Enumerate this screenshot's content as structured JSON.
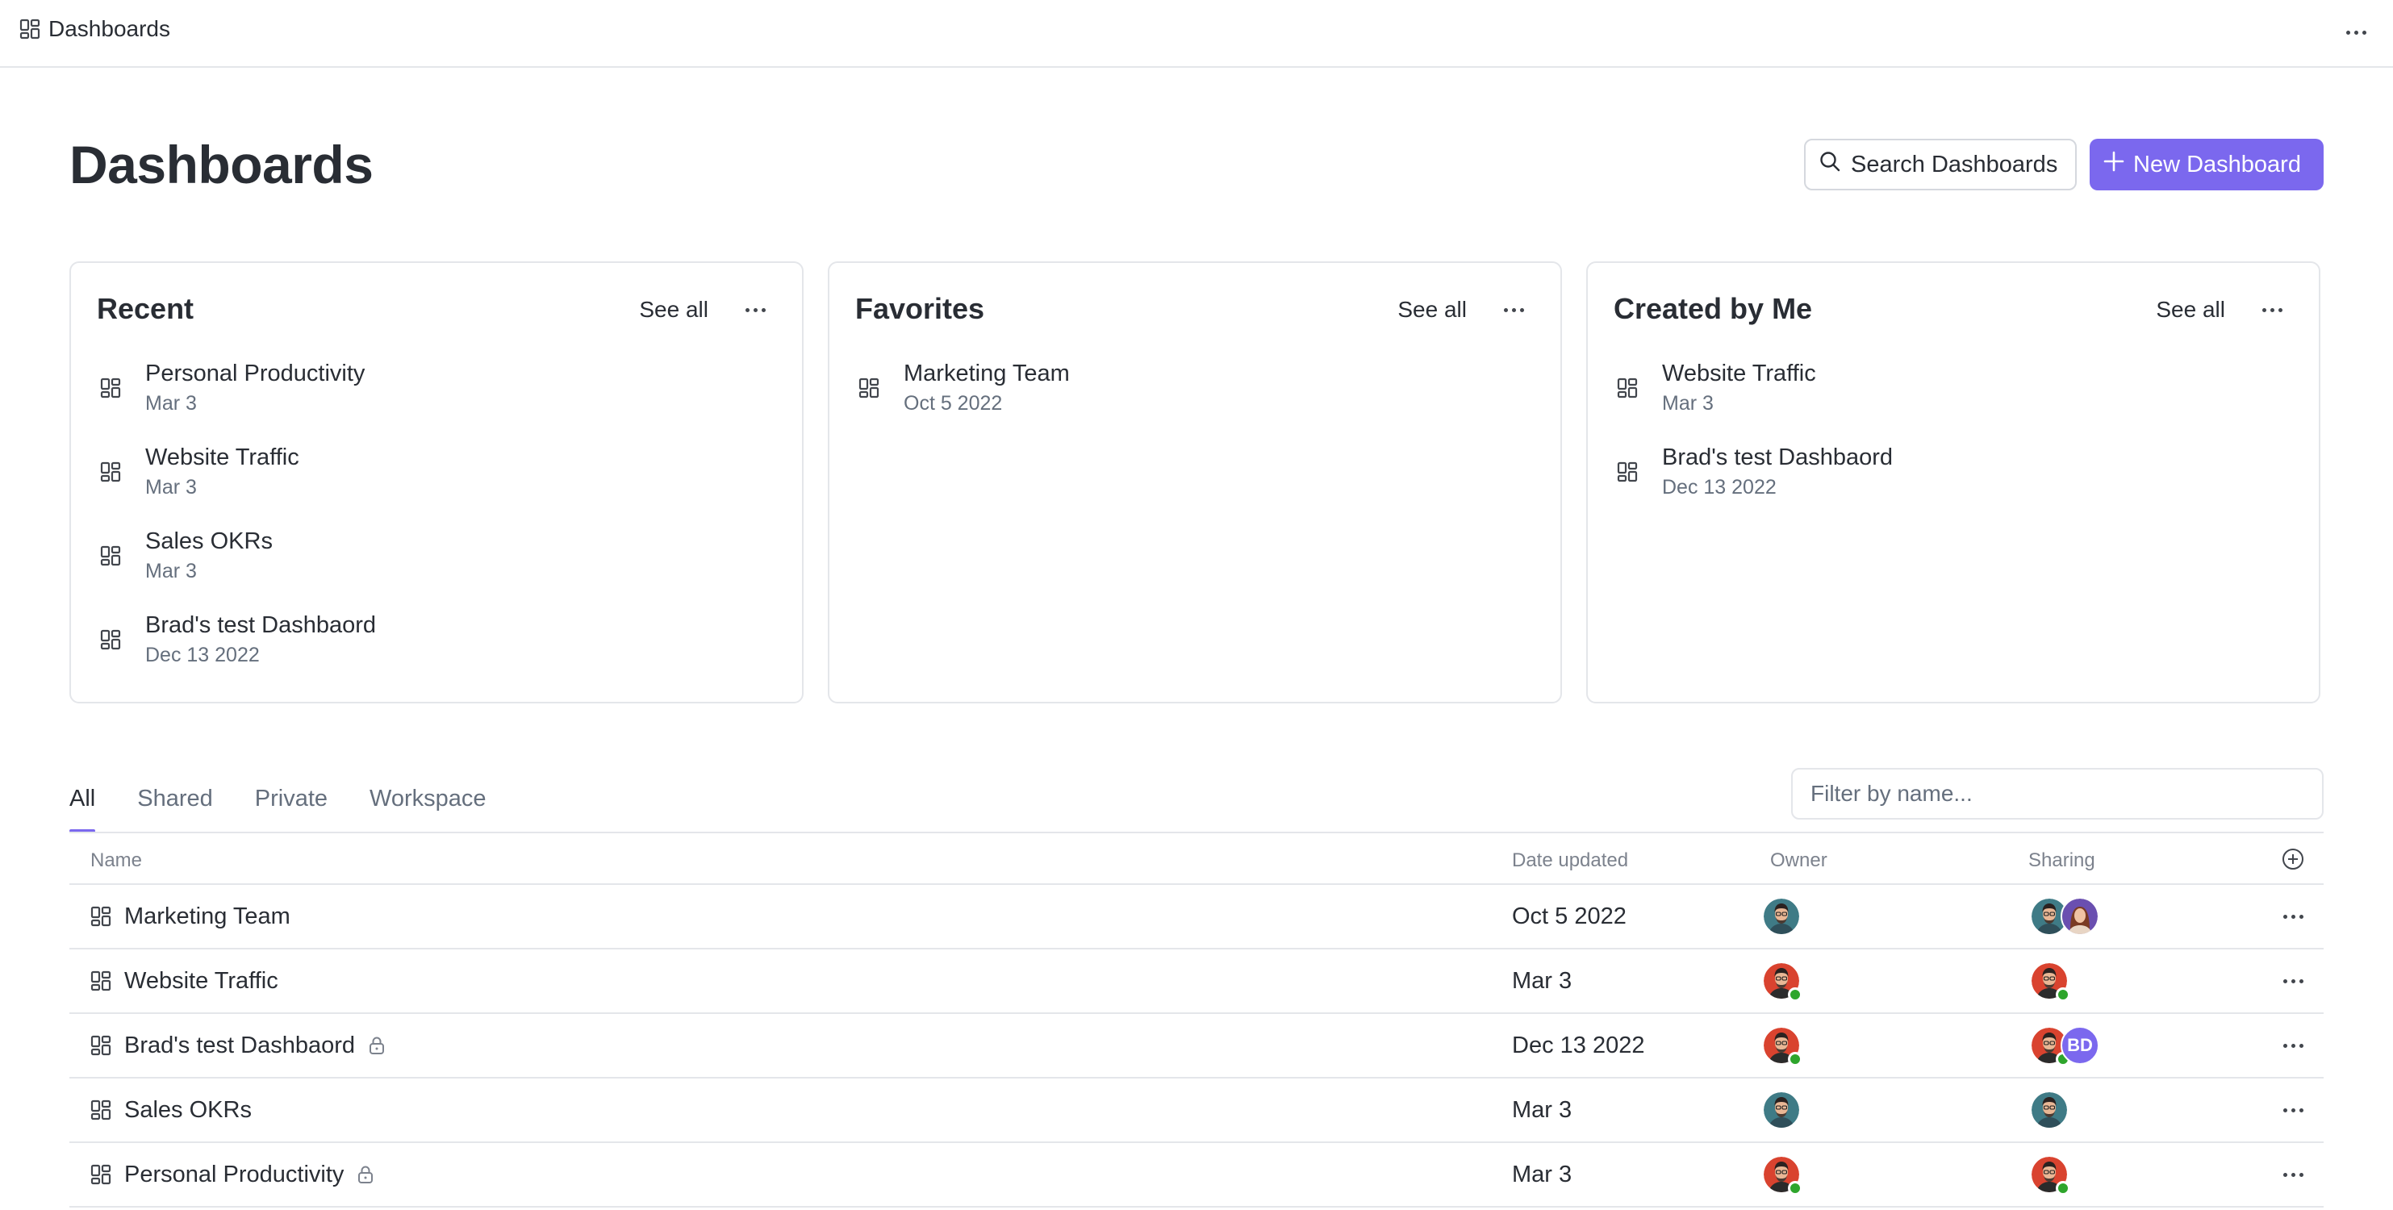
{
  "topbar": {
    "breadcrumb": "Dashboards"
  },
  "page": {
    "title": "Dashboards"
  },
  "actions": {
    "search_label": "Search Dashboards",
    "new_label": "New Dashboard"
  },
  "cards": [
    {
      "title": "Recent",
      "see_all": "See all",
      "items": [
        {
          "name": "Personal Productivity",
          "date": "Mar 3"
        },
        {
          "name": "Website Traffic",
          "date": "Mar 3"
        },
        {
          "name": "Sales OKRs",
          "date": "Mar 3"
        },
        {
          "name": "Brad's test Dashbaord",
          "date": "Dec 13 2022"
        }
      ]
    },
    {
      "title": "Favorites",
      "see_all": "See all",
      "items": [
        {
          "name": "Marketing Team",
          "date": "Oct 5 2022"
        }
      ]
    },
    {
      "title": "Created by Me",
      "see_all": "See all",
      "items": [
        {
          "name": "Website Traffic",
          "date": "Mar 3"
        },
        {
          "name": "Brad's test Dashbaord",
          "date": "Dec 13 2022"
        }
      ]
    }
  ],
  "tabs": [
    "All",
    "Shared",
    "Private",
    "Workspace"
  ],
  "active_tab": "All",
  "filter": {
    "placeholder": "Filter by name..."
  },
  "table": {
    "columns": {
      "name": "Name",
      "date": "Date updated",
      "owner": "Owner",
      "sharing": "Sharing"
    },
    "rows": [
      {
        "name": "Marketing Team",
        "locked": false,
        "date": "Oct 5 2022",
        "owner": "teal",
        "sharing": [
          "teal",
          "woman"
        ]
      },
      {
        "name": "Website Traffic",
        "locked": false,
        "date": "Mar 3",
        "owner": "red-online",
        "sharing": [
          "red-online"
        ]
      },
      {
        "name": "Brad's test Dashbaord",
        "locked": true,
        "date": "Dec 13 2022",
        "owner": "red-online",
        "sharing": [
          "red-online",
          "BD"
        ]
      },
      {
        "name": "Sales OKRs",
        "locked": false,
        "date": "Mar 3",
        "owner": "teal",
        "sharing": [
          "teal"
        ]
      },
      {
        "name": "Personal Productivity",
        "locked": true,
        "date": "Mar 3",
        "owner": "red-online",
        "sharing": [
          "red-online"
        ]
      }
    ]
  },
  "colors": {
    "accent": "#7b68ee",
    "online": "#2ea52c"
  },
  "icons": [
    "dashboard-icon",
    "search-icon",
    "plus-icon",
    "more-icon",
    "lock-icon",
    "add-column-icon"
  ]
}
